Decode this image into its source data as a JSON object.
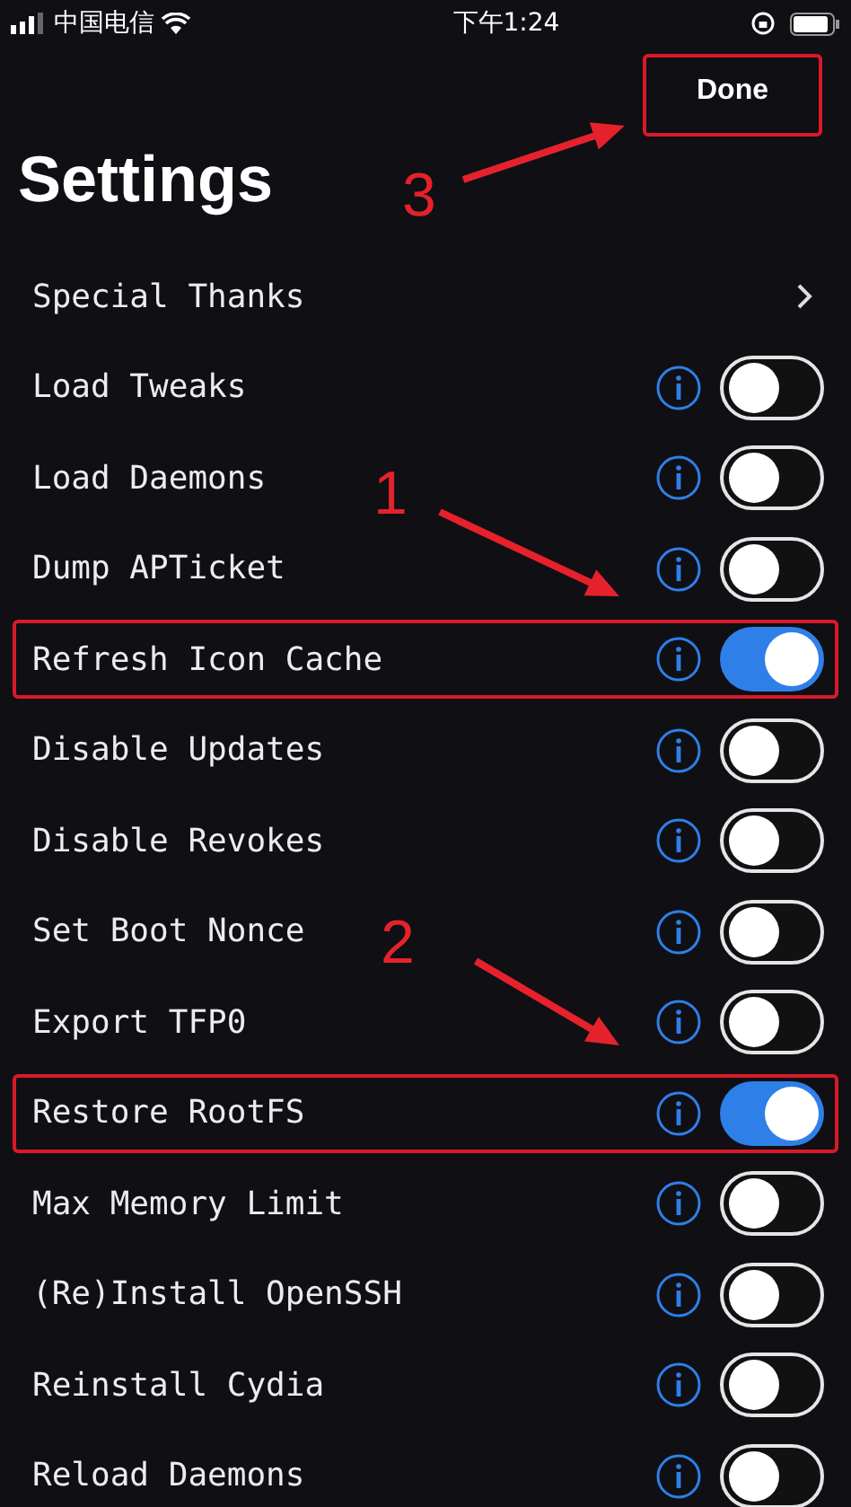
{
  "status_bar": {
    "carrier": "中国电信",
    "time": "下午1:24"
  },
  "nav": {
    "done": "Done",
    "highlighted": true
  },
  "title": "Settings",
  "rows": [
    {
      "kind": "link",
      "label": "Special Thanks",
      "highlighted": false
    },
    {
      "kind": "toggle",
      "label": "Load Tweaks",
      "on": false,
      "highlighted": false
    },
    {
      "kind": "toggle",
      "label": "Load Daemons",
      "on": false,
      "highlighted": false
    },
    {
      "kind": "toggle",
      "label": "Dump APTicket",
      "on": false,
      "highlighted": false
    },
    {
      "kind": "toggle",
      "label": "Refresh Icon Cache",
      "on": true,
      "highlighted": true
    },
    {
      "kind": "toggle",
      "label": "Disable Updates",
      "on": false,
      "highlighted": false
    },
    {
      "kind": "toggle",
      "label": "Disable Revokes",
      "on": false,
      "highlighted": false
    },
    {
      "kind": "toggle",
      "label": "Set Boot Nonce",
      "on": false,
      "highlighted": false
    },
    {
      "kind": "toggle",
      "label": "Export TFP0",
      "on": false,
      "highlighted": false
    },
    {
      "kind": "toggle",
      "label": "Restore RootFS",
      "on": true,
      "highlighted": true
    },
    {
      "kind": "toggle",
      "label": "Max Memory Limit",
      "on": false,
      "highlighted": false
    },
    {
      "kind": "toggle",
      "label": "(Re)Install OpenSSH",
      "on": false,
      "highlighted": false
    },
    {
      "kind": "toggle",
      "label": "Reinstall Cydia",
      "on": false,
      "highlighted": false
    },
    {
      "kind": "toggle",
      "label": "Reload Daemons",
      "on": false,
      "highlighted": false
    }
  ],
  "annotations": [
    {
      "label": "3"
    },
    {
      "label": "1"
    },
    {
      "label": "2"
    }
  ]
}
